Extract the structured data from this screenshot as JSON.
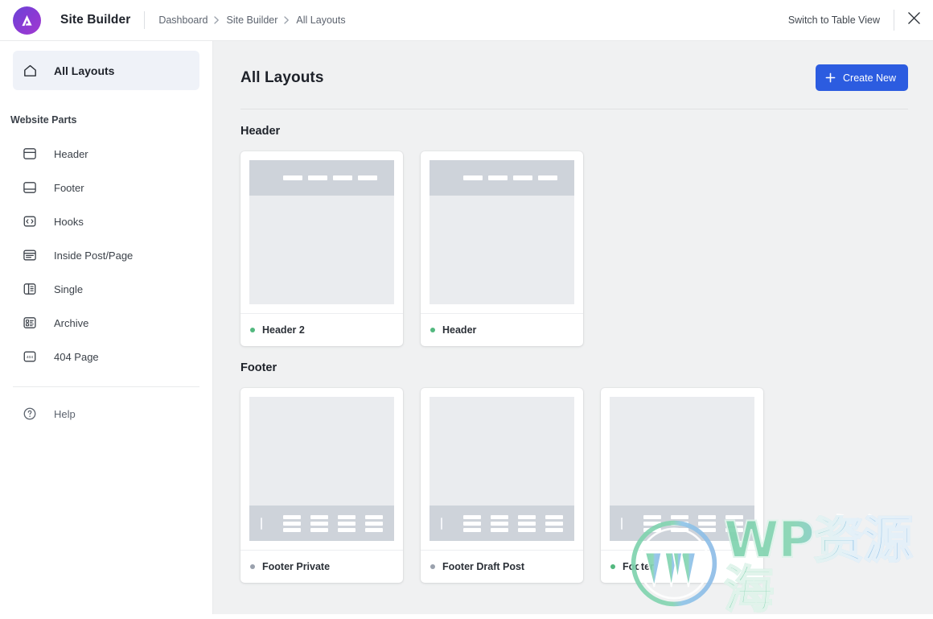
{
  "topbar": {
    "logo_icon": "astra-logo-icon",
    "app_title": "Site Builder",
    "breadcrumbs": [
      {
        "label": "Dashboard"
      },
      {
        "label": "Site Builder"
      },
      {
        "label": "All Layouts"
      }
    ],
    "crumb_separator": "❯",
    "switch_view_label": "Switch to Table View",
    "close_icon": "close-icon"
  },
  "sidebar": {
    "primary": [
      {
        "label": "All Layouts",
        "icon": "home-icon",
        "active": true
      }
    ],
    "section_label": "Website Parts",
    "items": [
      {
        "label": "Header",
        "icon": "header-layout-icon"
      },
      {
        "label": "Footer",
        "icon": "footer-layout-icon"
      },
      {
        "label": "Hooks",
        "icon": "code-brackets-icon"
      },
      {
        "label": "Inside Post/Page",
        "icon": "inside-post-icon"
      },
      {
        "label": "Single",
        "icon": "single-layout-icon"
      },
      {
        "label": "Archive",
        "icon": "archive-grid-icon"
      },
      {
        "label": "404 Page",
        "icon": "404-page-icon"
      }
    ],
    "help": {
      "label": "Help",
      "icon": "question-circle-icon"
    }
  },
  "main": {
    "page_title": "All Layouts",
    "create_button": {
      "label": "Create New",
      "icon": "plus-icon"
    },
    "groups": [
      {
        "title": "Header",
        "cards": [
          {
            "label": "Header 2",
            "status": "published",
            "status_color": "#53b87f",
            "preview": "header"
          },
          {
            "label": "Header",
            "status": "published",
            "status_color": "#53b87f",
            "preview": "header"
          }
        ]
      },
      {
        "title": "Footer",
        "cards": [
          {
            "label": "Footer Private",
            "status": "private",
            "status_color": "#9aa1ad",
            "preview": "footer"
          },
          {
            "label": "Footer Draft Post",
            "status": "draft",
            "status_color": "#9aa1ad",
            "preview": "footer"
          },
          {
            "label": "Footer",
            "status": "published",
            "status_color": "#53b87f",
            "preview": "footer"
          }
        ]
      }
    ]
  },
  "watermark": {
    "logo_icon": "wordpress-logo-icon",
    "text": "WP资源海"
  },
  "colors": {
    "accent_blue": "#2c5ce0",
    "logo_gradient_start": "#6a43d6",
    "logo_gradient_end": "#a13bd0",
    "status_published": "#53b87f",
    "status_muted": "#9aa1ad",
    "sidebar_active_bg": "#eff2f8",
    "main_bg": "#f0f1f2"
  }
}
